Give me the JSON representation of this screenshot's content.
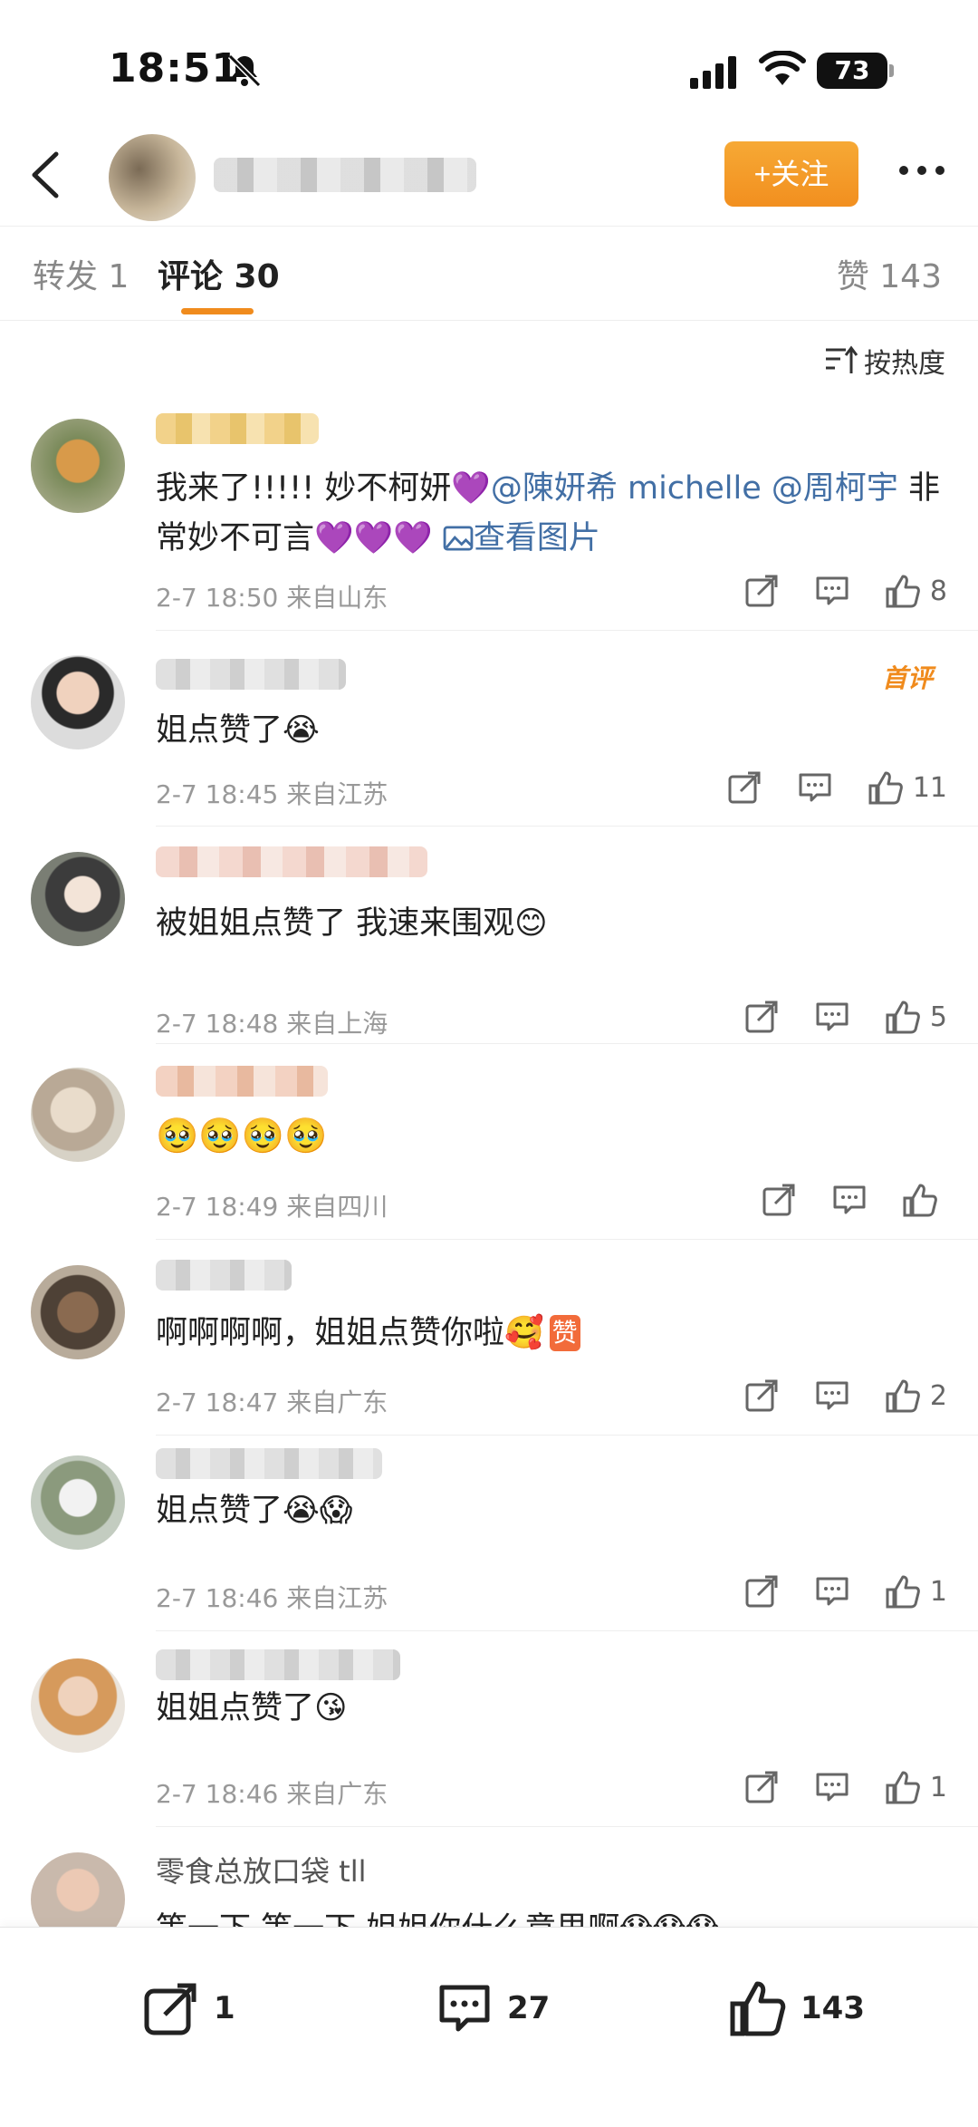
{
  "status": {
    "time": "18:51",
    "battery": "73"
  },
  "header": {
    "follow_label": "+关注"
  },
  "tabs": {
    "repost": "转发 1",
    "comments": "评论 30",
    "likes": "赞 143"
  },
  "sort": {
    "label": "按热度"
  },
  "comments": [
    {
      "text": "我来了!!!!!  妙不柯妍💜",
      "mention": "@陳妍希 michelle @周柯宇",
      "text2": " 非常妙不可言💜💜💜 ",
      "image_link": "查看图片",
      "meta": "2-7 18:50 来自山东",
      "likes": "8"
    },
    {
      "text": "姐点赞了😭",
      "meta": "2-7 18:45 来自江苏",
      "likes": "11",
      "badge": "首评"
    },
    {
      "text": "被姐姐点赞了 我速来围观😊",
      "meta": "2-7 18:48 来自上海",
      "likes": "5"
    },
    {
      "text": "🥹🥹🥹🥹",
      "meta": "2-7 18:49 来自四川",
      "likes": ""
    },
    {
      "text": "啊啊啊啊，姐姐点赞你啦🥰",
      "stamp": "赞",
      "meta": "2-7 18:47 来自广东",
      "likes": "2"
    },
    {
      "text": "姐点赞了😭😱",
      "meta": "2-7 18:46 来自江苏",
      "likes": "1"
    },
    {
      "text": "姐姐点赞了😘",
      "meta": "2-7 18:46 来自广东",
      "likes": "1"
    },
    {
      "name_partial": "零食总放口袋 tll",
      "text": "等一下 等一下 姐姐你什么意思啊😱😱😱"
    }
  ],
  "bottom": {
    "share_count": "1",
    "comment_count": "27",
    "like_count": "143"
  },
  "colors": {
    "accent_orange": "#f08b1d",
    "mention_blue": "#426fa5"
  },
  "icons": [
    "back-arrow-icon",
    "bell-slash-icon",
    "signal-icon",
    "wifi-icon",
    "more-icon",
    "sort-icon",
    "repost-icon",
    "comment-icon",
    "like-icon",
    "image-icon"
  ]
}
